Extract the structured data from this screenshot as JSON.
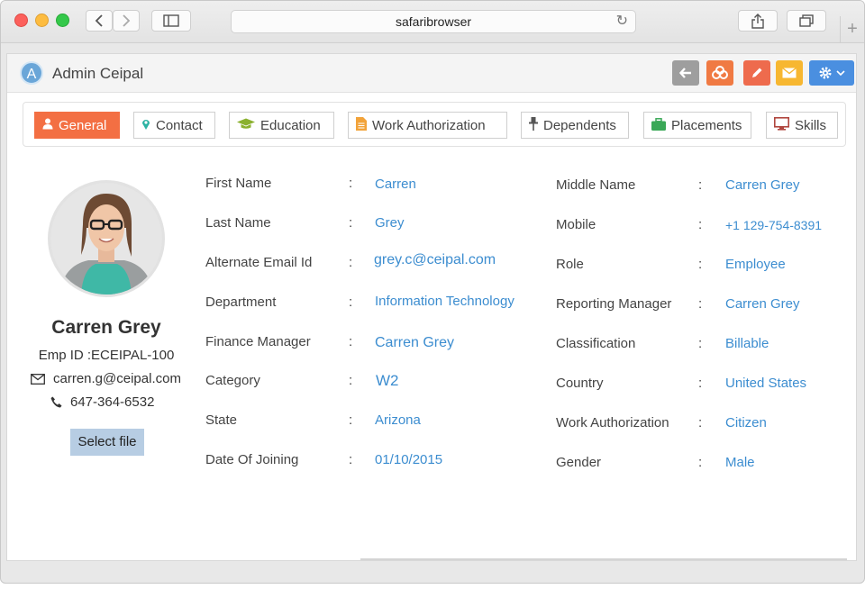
{
  "browser": {
    "address": "safaribrowser"
  },
  "header": {
    "initial": "A",
    "title": "Admin Ceipal"
  },
  "tabs": [
    {
      "label": "General",
      "icon": "user-icon"
    },
    {
      "label": "Contact",
      "icon": "map-marker-icon"
    },
    {
      "label": "Education",
      "icon": "graduation-cap-icon"
    },
    {
      "label": "Work Authorization",
      "icon": "document-icon"
    },
    {
      "label": "Dependents",
      "icon": "pin-icon"
    },
    {
      "label": "Placements",
      "icon": "briefcase-icon"
    },
    {
      "label": "Skills",
      "icon": "monitor-icon"
    }
  ],
  "profile": {
    "name": "Carren Grey",
    "emp_id": "Emp ID :ECEIPAL-100",
    "email": "carren.g@ceipal.com",
    "phone": "647-364-6532",
    "select_file": "Select file"
  },
  "left_fields": [
    {
      "label": "First Name",
      "value": "Carren"
    },
    {
      "label": "Last Name",
      "value": "Grey"
    },
    {
      "label": "Alternate Email Id",
      "value": "grey.c@ceipal.com"
    },
    {
      "label": "Department",
      "value": "Information Technology"
    },
    {
      "label": "Finance Manager",
      "value": "Carren Grey"
    },
    {
      "label": "Category",
      "value": "W2"
    },
    {
      "label": "State",
      "value": "Arizona"
    },
    {
      "label": "Date Of Joining",
      "value": "01/10/2015"
    }
  ],
  "right_fields": [
    {
      "label": "Middle Name",
      "value": "Carren Grey"
    },
    {
      "label": "Mobile",
      "value": "+1 129-754-8391"
    },
    {
      "label": "Role",
      "value": "Employee"
    },
    {
      "label": "Reporting Manager",
      "value": "Carren Grey"
    },
    {
      "label": "Classification",
      "value": "Billable"
    },
    {
      "label": "Country",
      "value": "United States"
    },
    {
      "label": "Work Authorization",
      "value": "Citizen"
    },
    {
      "label": "Gender",
      "value": "Male"
    }
  ],
  "colors": {
    "accent": "#f36f43",
    "link": "#3c8dd0"
  }
}
